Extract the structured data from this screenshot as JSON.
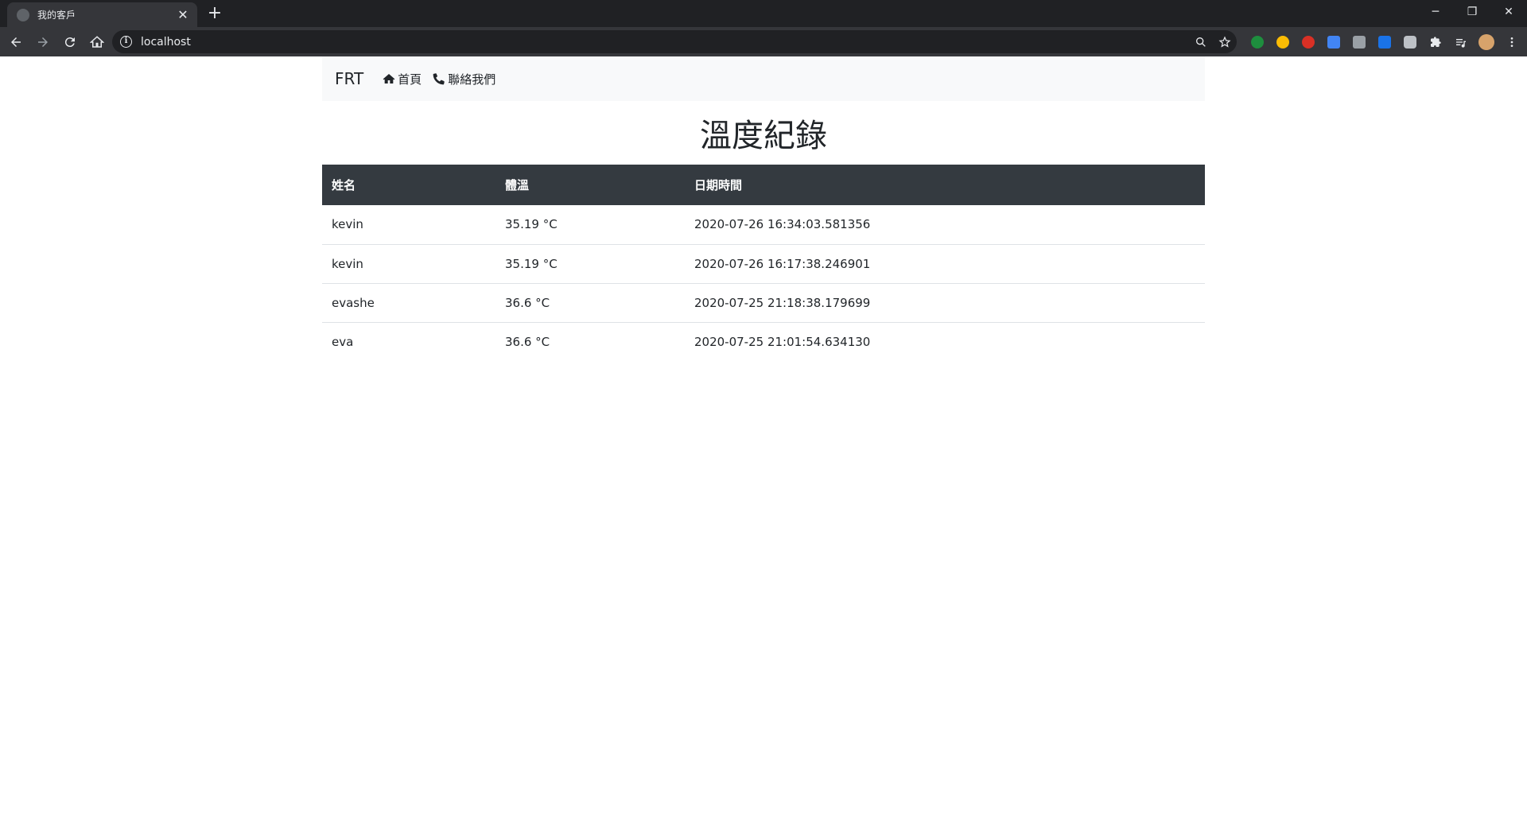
{
  "browser": {
    "tab_title": "我的客戶",
    "tab_close": "✕",
    "new_tab": "+",
    "url": "localhost",
    "window_controls": {
      "minimize": "─",
      "restore": "❐",
      "close": "✕"
    },
    "extensions": [
      {
        "name": "check-extension",
        "color": "#1e8e3e"
      },
      {
        "name": "chrome-extension",
        "color": "#fbbc04"
      },
      {
        "name": "red-extension",
        "color": "#d93025"
      },
      {
        "name": "translate-extension",
        "color": "#4285f4"
      },
      {
        "name": "drive-extension",
        "color": "#9aa0a6"
      },
      {
        "name": "blue-hex-extension",
        "color": "#1a73e8"
      },
      {
        "name": "line-extension",
        "color": "#bdc1c6"
      },
      {
        "name": "puzzle-extension",
        "color": "#e8eaed"
      },
      {
        "name": "reading-list-extension",
        "color": "#e8eaed"
      },
      {
        "name": "profile-avatar",
        "color": "#c58af9"
      }
    ]
  },
  "navbar": {
    "brand": "FRT",
    "links": [
      {
        "label": "首頁",
        "icon": "home-icon"
      },
      {
        "label": "聯絡我們",
        "icon": "phone-icon"
      }
    ]
  },
  "page": {
    "title": "溫度紀錄"
  },
  "table": {
    "headers": [
      "姓名",
      "體溫",
      "日期時間"
    ],
    "rows": [
      [
        "kevin",
        "35.19 °C",
        "2020-07-26 16:34:03.581356"
      ],
      [
        "kevin",
        "35.19 °C",
        "2020-07-26 16:17:38.246901"
      ],
      [
        "evashe",
        "36.6 °C",
        "2020-07-25 21:18:38.179699"
      ],
      [
        "eva",
        "36.6 °C",
        "2020-07-25 21:01:54.634130"
      ]
    ]
  }
}
